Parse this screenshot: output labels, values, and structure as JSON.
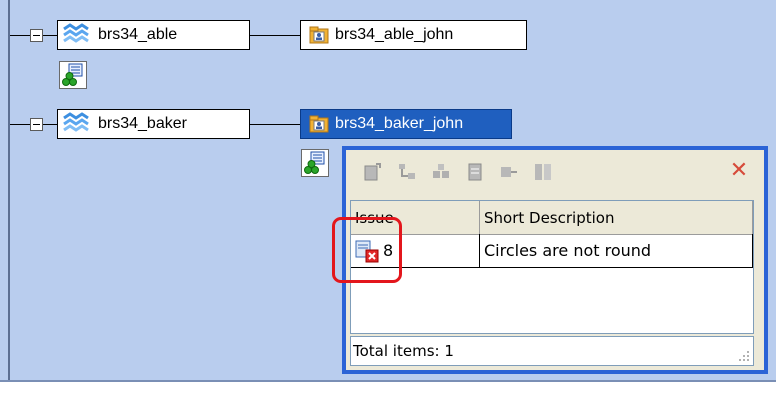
{
  "tree": {
    "nodes": [
      {
        "label": "brs34_able",
        "child_label": "brs34_able_john",
        "child_selected": false
      },
      {
        "label": "brs34_baker",
        "child_label": "brs34_baker_john",
        "child_selected": true
      }
    ]
  },
  "issues_popup": {
    "columns": [
      "Issue",
      "Short Description"
    ],
    "rows": [
      {
        "issue": "8",
        "description": "Circles are not round"
      }
    ],
    "status": "Total items: 1"
  },
  "colors": {
    "canvas": "#b9cdee",
    "selection": "#1f5fbf",
    "popup_border": "#2b63d6",
    "highlight": "#e3161c"
  }
}
